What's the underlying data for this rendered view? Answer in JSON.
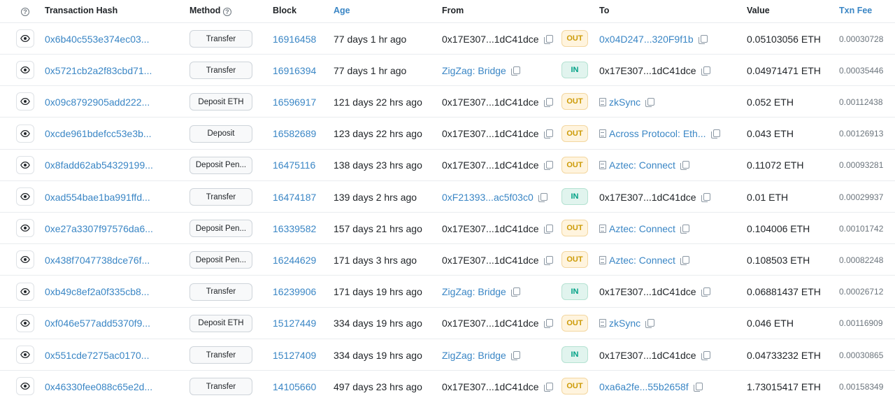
{
  "header": {
    "help_icon": "?",
    "transaction_hash": "Transaction Hash",
    "method": "Method",
    "method_help_icon": "?",
    "block": "Block",
    "age": "Age",
    "from": "From",
    "to": "To",
    "value": "Value",
    "txn_fee": "Txn Fee"
  },
  "colors": {
    "link": "#3a86c5",
    "out_badge_bg": "#fff4de",
    "out_badge_text": "#cc9a06",
    "in_badge_bg": "#e1f4ee",
    "in_badge_text": "#00a186"
  },
  "rows": [
    {
      "hash": "0x6b40c553e374ec03...",
      "method": "Transfer",
      "block": "16916458",
      "age": "77 days 1 hr ago",
      "from": "0x17E307...1dC41dce",
      "from_link": false,
      "direction": "OUT",
      "to": "0x04D247...320F9f1b",
      "to_link": true,
      "to_contract": false,
      "value": "0.05103056 ETH",
      "fee": "0.00030728"
    },
    {
      "hash": "0x5721cb2a2f83cbd71...",
      "method": "Transfer",
      "block": "16916394",
      "age": "77 days 1 hr ago",
      "from": "ZigZag: Bridge",
      "from_link": true,
      "direction": "IN",
      "to": "0x17E307...1dC41dce",
      "to_link": false,
      "to_contract": false,
      "value": "0.04971471 ETH",
      "fee": "0.00035446"
    },
    {
      "hash": "0x09c8792905add222...",
      "method": "Deposit ETH",
      "block": "16596917",
      "age": "121 days 22 hrs ago",
      "from": "0x17E307...1dC41dce",
      "from_link": false,
      "direction": "OUT",
      "to": "zkSync",
      "to_link": true,
      "to_contract": true,
      "value": "0.052 ETH",
      "fee": "0.00112438"
    },
    {
      "hash": "0xcde961bdefcc53e3b...",
      "method": "Deposit",
      "block": "16582689",
      "age": "123 days 22 hrs ago",
      "from": "0x17E307...1dC41dce",
      "from_link": false,
      "direction": "OUT",
      "to": "Across Protocol: Eth...",
      "to_link": true,
      "to_contract": true,
      "value": "0.043 ETH",
      "fee": "0.00126913"
    },
    {
      "hash": "0x8fadd62ab54329199...",
      "method": "Deposit Pen...",
      "block": "16475116",
      "age": "138 days 23 hrs ago",
      "from": "0x17E307...1dC41dce",
      "from_link": false,
      "direction": "OUT",
      "to": "Aztec: Connect",
      "to_link": true,
      "to_contract": true,
      "value": "0.11072 ETH",
      "fee": "0.00093281"
    },
    {
      "hash": "0xad554bae1ba991ffd...",
      "method": "Transfer",
      "block": "16474187",
      "age": "139 days 2 hrs ago",
      "from": "0xF21393...ac5f03c0",
      "from_link": true,
      "direction": "IN",
      "to": "0x17E307...1dC41dce",
      "to_link": false,
      "to_contract": false,
      "value": "0.01 ETH",
      "fee": "0.00029937"
    },
    {
      "hash": "0xe27a3307f97576da6...",
      "method": "Deposit Pen...",
      "block": "16339582",
      "age": "157 days 21 hrs ago",
      "from": "0x17E307...1dC41dce",
      "from_link": false,
      "direction": "OUT",
      "to": "Aztec: Connect",
      "to_link": true,
      "to_contract": true,
      "value": "0.104006 ETH",
      "fee": "0.00101742"
    },
    {
      "hash": "0x438f7047738dce76f...",
      "method": "Deposit Pen...",
      "block": "16244629",
      "age": "171 days 3 hrs ago",
      "from": "0x17E307...1dC41dce",
      "from_link": false,
      "direction": "OUT",
      "to": "Aztec: Connect",
      "to_link": true,
      "to_contract": true,
      "value": "0.108503 ETH",
      "fee": "0.00082248"
    },
    {
      "hash": "0xb49c8ef2a0f335cb8...",
      "method": "Transfer",
      "block": "16239906",
      "age": "171 days 19 hrs ago",
      "from": "ZigZag: Bridge",
      "from_link": true,
      "direction": "IN",
      "to": "0x17E307...1dC41dce",
      "to_link": false,
      "to_contract": false,
      "value": "0.06881437 ETH",
      "fee": "0.00026712"
    },
    {
      "hash": "0xf046e577add5370f9...",
      "method": "Deposit ETH",
      "block": "15127449",
      "age": "334 days 19 hrs ago",
      "from": "0x17E307...1dC41dce",
      "from_link": false,
      "direction": "OUT",
      "to": "zkSync",
      "to_link": true,
      "to_contract": true,
      "value": "0.046 ETH",
      "fee": "0.00116909"
    },
    {
      "hash": "0x551cde7275ac0170...",
      "method": "Transfer",
      "block": "15127409",
      "age": "334 days 19 hrs ago",
      "from": "ZigZag: Bridge",
      "from_link": true,
      "direction": "IN",
      "to": "0x17E307...1dC41dce",
      "to_link": false,
      "to_contract": false,
      "value": "0.04733232 ETH",
      "fee": "0.00030865"
    },
    {
      "hash": "0x46330fee088c65e2d...",
      "method": "Transfer",
      "block": "14105660",
      "age": "497 days 23 hrs ago",
      "from": "0x17E307...1dC41dce",
      "from_link": false,
      "direction": "OUT",
      "to": "0xa6a2fe...55b2658f",
      "to_link": true,
      "to_contract": false,
      "value": "1.73015417 ETH",
      "fee": "0.00158349"
    }
  ]
}
